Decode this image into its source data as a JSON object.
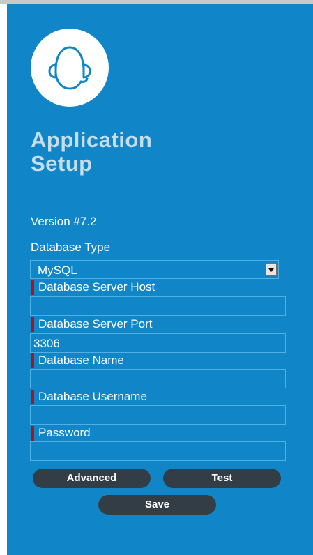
{
  "header": {
    "title_line1": "Application",
    "title_line2": "Setup",
    "logo_icon": "headset-icon"
  },
  "version": "Version #7.2",
  "form": {
    "database_type": {
      "label": "Database Type",
      "value": "MySQL"
    },
    "server_host": {
      "label": "Database Server Host",
      "value": "",
      "required": true
    },
    "server_port": {
      "label": "Database Server Port",
      "value": "3306",
      "required": true
    },
    "db_name": {
      "label": "Database Name",
      "value": "",
      "required": true
    },
    "db_username": {
      "label": "Database Username",
      "value": "",
      "required": true
    },
    "password": {
      "label": "Password",
      "value": "",
      "required": true
    }
  },
  "buttons": {
    "advanced": "Advanced",
    "test": "Test",
    "save": "Save"
  },
  "colors": {
    "panel": "#1086c8",
    "title": "#c8ddea",
    "required_marker": "#b0121b",
    "button": "#333d45"
  }
}
